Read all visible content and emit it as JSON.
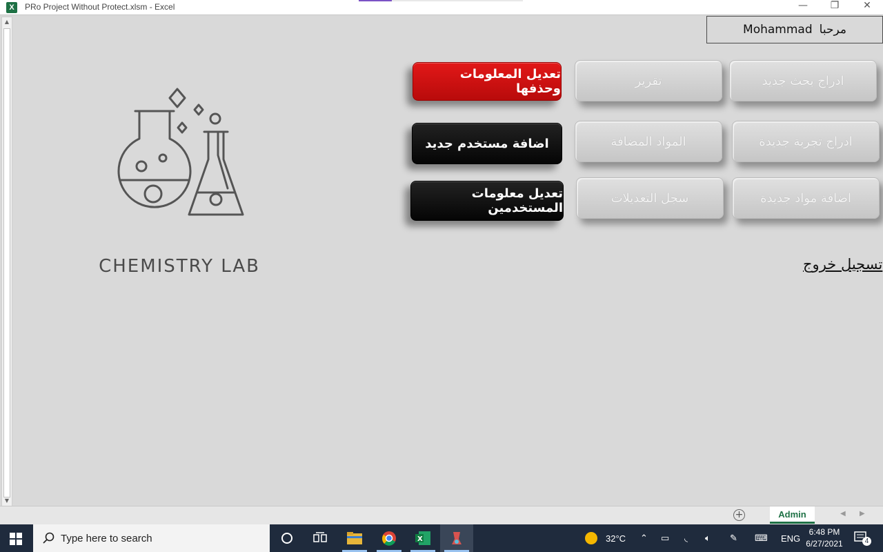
{
  "window": {
    "title": "PRo Project Without Protect.xlsm  -  Excel",
    "app_icon": "X",
    "minimize": "—",
    "restore": "❐",
    "close": "✕"
  },
  "header": {
    "greeting": "مرحبا",
    "user_name": "Mohammad"
  },
  "buttons": {
    "new_research": "ادراج بحث جديد",
    "report": "تقرير",
    "edit_delete_info": "تعديل المعلومات وحذفها",
    "new_experiment": "ادراج تجربة جديدة",
    "added_materials": "المواد المضافة",
    "add_user": "اضافة مستخدم جديد",
    "add_materials": "اضافة مواد جديدة",
    "edit_log": "سجل التعديلات",
    "edit_users": "تعديل معلومات المستخدمين"
  },
  "logout": "تسجيل خروج",
  "logo": {
    "text": "CHEMISTRY LAB",
    "icon": "flask-icon"
  },
  "sheet_tabs": {
    "active": "Admin",
    "add_symbol": "+"
  },
  "taskbar": {
    "search_placeholder": "Type here to search",
    "temperature": "32°C",
    "language": "ENG",
    "time": "6:48 PM",
    "date": "6/27/2021",
    "notification_count": "4"
  },
  "colors": {
    "sheet_bg": "#d9d9d9",
    "red_button": "#d41414",
    "black_button": "#111111",
    "gray_button": "#cfcfcf",
    "excel_green": "#1e7145",
    "taskbar": "#1f2b3d"
  }
}
